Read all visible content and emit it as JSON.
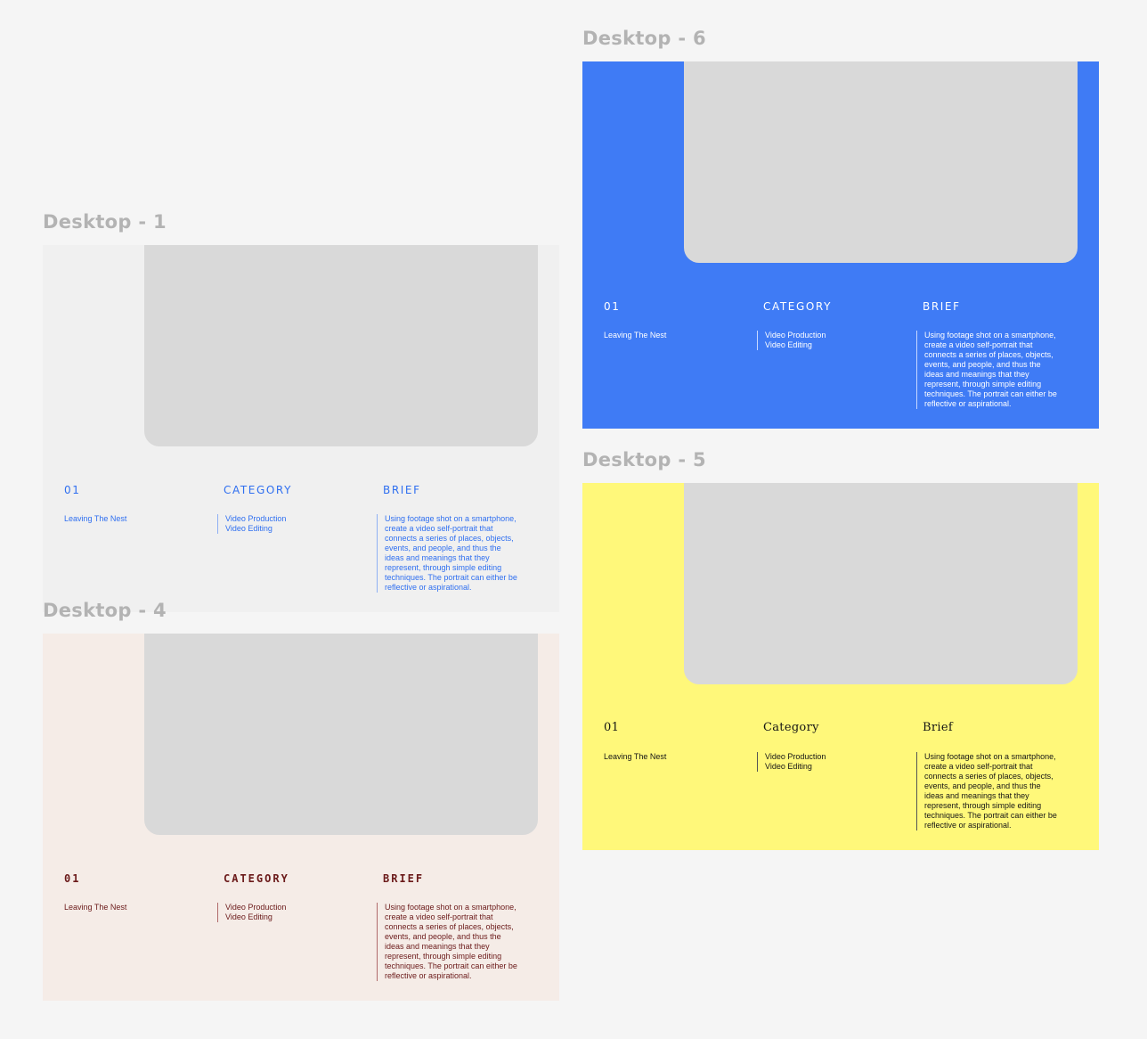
{
  "colors": {
    "canvas": "#f5f5f5",
    "frame_label": "#b3b3b3",
    "placeholder": "#d9d9d9",
    "desktop1_bg": "#f0f0f0",
    "desktop1_text": "#2f6ff0",
    "desktop4_bg": "#f5ece7",
    "desktop4_text": "#6b1a1a",
    "desktop6_bg": "#3f7bf5",
    "desktop6_text": "#ffffff",
    "desktop5_bg": "#fff87a",
    "desktop5_text": "#151515"
  },
  "frames": [
    {
      "label": "Desktop - 6",
      "number": "01",
      "category_heading": "CATEGORY",
      "brief_heading": "BRIEF",
      "project_title": "Leaving The Nest",
      "category_items": [
        "Video Production",
        "Video Editing"
      ],
      "brief": "Using footage shot on a smartphone,\ncreate a video self-portrait that\nconnects a series of places, objects,\nevents, and people, and thus the\nideas and meanings that they\nrepresent, through simple editing\ntechniques. The portrait can either be\nreflective or aspirational."
    },
    {
      "label": "Desktop - 1",
      "number": "01",
      "category_heading": "CATEGORY",
      "brief_heading": "BRIEF",
      "project_title": "Leaving The Nest",
      "category_items": [
        "Video Production",
        "Video Editing"
      ],
      "brief": "Using footage shot on a smartphone,\ncreate a video self-portrait that\nconnects a series of places, objects,\nevents, and people, and thus the\nideas and meanings that they\nrepresent, through simple editing\ntechniques. The portrait can either be\nreflective or aspirational."
    },
    {
      "label": "Desktop - 5",
      "number": "01",
      "category_heading": "Category",
      "brief_heading": "Brief",
      "project_title": "Leaving The Nest",
      "category_items": [
        "Video Production",
        "Video Editing"
      ],
      "brief": "Using footage shot on a smartphone,\ncreate a video self-portrait that\nconnects a series of places, objects,\nevents, and people, and thus the\nideas and meanings that they\nrepresent, through simple editing\ntechniques. The portrait can either be\nreflective or aspirational."
    },
    {
      "label": "Desktop - 4",
      "number": "01",
      "category_heading": "CATEGORY",
      "brief_heading": "BRIEF",
      "project_title": "Leaving The Nest",
      "category_items": [
        "Video Production",
        "Video Editing"
      ],
      "brief": "Using footage shot on a smartphone,\ncreate a video self-portrait that\nconnects a series of places, objects,\nevents, and people, and thus the\nideas and meanings that they\nrepresent, through simple editing\ntechniques. The portrait can either be\nreflective or aspirational."
    }
  ]
}
